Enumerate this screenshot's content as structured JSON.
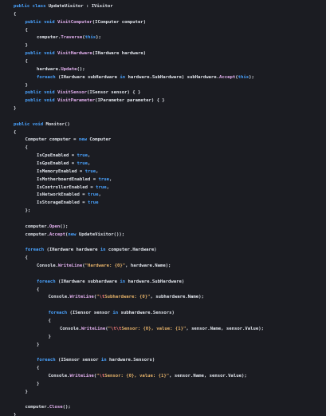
{
  "editor": {
    "theme_colors": {
      "background": "#1b1c22",
      "text": "#dfe3ea",
      "keyword": "#4aa3ff",
      "method": "#e4b1f0",
      "string": "#e7b36a",
      "escape": "#ff7e7e"
    },
    "lines": [
      {
        "indent": 0,
        "tokens": [
          {
            "t": "kw",
            "v": "public"
          },
          {
            "t": "txt",
            "v": " "
          },
          {
            "t": "kw",
            "v": "class"
          },
          {
            "t": "txt",
            "v": " UpdateVisitor : IVisitor"
          }
        ]
      },
      {
        "indent": 0,
        "tokens": [
          {
            "t": "txt",
            "v": "{"
          }
        ]
      },
      {
        "indent": 1,
        "tokens": [
          {
            "t": "kw",
            "v": "public"
          },
          {
            "t": "txt",
            "v": " "
          },
          {
            "t": "kw",
            "v": "void"
          },
          {
            "t": "txt",
            "v": " "
          },
          {
            "t": "mth",
            "v": "VisitComputer"
          },
          {
            "t": "txt",
            "v": "(IComputer computer)"
          }
        ]
      },
      {
        "indent": 1,
        "tokens": [
          {
            "t": "txt",
            "v": "{"
          }
        ]
      },
      {
        "indent": 2,
        "tokens": [
          {
            "t": "txt",
            "v": "computer."
          },
          {
            "t": "mth",
            "v": "Traverse"
          },
          {
            "t": "txt",
            "v": "("
          },
          {
            "t": "kw",
            "v": "this"
          },
          {
            "t": "txt",
            "v": ");"
          }
        ]
      },
      {
        "indent": 1,
        "tokens": [
          {
            "t": "txt",
            "v": "}"
          }
        ]
      },
      {
        "indent": 1,
        "tokens": [
          {
            "t": "kw",
            "v": "public"
          },
          {
            "t": "txt",
            "v": " "
          },
          {
            "t": "kw",
            "v": "void"
          },
          {
            "t": "txt",
            "v": " "
          },
          {
            "t": "mth",
            "v": "VisitHardware"
          },
          {
            "t": "txt",
            "v": "(IHardware hardware)"
          }
        ]
      },
      {
        "indent": 1,
        "tokens": [
          {
            "t": "txt",
            "v": "{"
          }
        ]
      },
      {
        "indent": 2,
        "tokens": [
          {
            "t": "txt",
            "v": "hardware."
          },
          {
            "t": "mth",
            "v": "Update"
          },
          {
            "t": "txt",
            "v": "();"
          }
        ]
      },
      {
        "indent": 2,
        "tokens": [
          {
            "t": "kw",
            "v": "foreach"
          },
          {
            "t": "txt",
            "v": " (IHardware subHardware "
          },
          {
            "t": "kw",
            "v": "in"
          },
          {
            "t": "txt",
            "v": " hardware.SubHardware) subHardware."
          },
          {
            "t": "mth",
            "v": "Accept"
          },
          {
            "t": "txt",
            "v": "("
          },
          {
            "t": "kw",
            "v": "this"
          },
          {
            "t": "txt",
            "v": ");"
          }
        ]
      },
      {
        "indent": 1,
        "tokens": [
          {
            "t": "txt",
            "v": "}"
          }
        ]
      },
      {
        "indent": 1,
        "tokens": [
          {
            "t": "kw",
            "v": "public"
          },
          {
            "t": "txt",
            "v": " "
          },
          {
            "t": "kw",
            "v": "void"
          },
          {
            "t": "txt",
            "v": " "
          },
          {
            "t": "mth",
            "v": "VisitSensor"
          },
          {
            "t": "txt",
            "v": "(ISensor sensor) { }"
          }
        ]
      },
      {
        "indent": 1,
        "tokens": [
          {
            "t": "kw",
            "v": "public"
          },
          {
            "t": "txt",
            "v": " "
          },
          {
            "t": "kw",
            "v": "void"
          },
          {
            "t": "txt",
            "v": " "
          },
          {
            "t": "mth",
            "v": "VisitParameter"
          },
          {
            "t": "txt",
            "v": "(IParameter parameter) { }"
          }
        ]
      },
      {
        "indent": 0,
        "tokens": [
          {
            "t": "txt",
            "v": "}"
          }
        ]
      },
      {
        "indent": 0,
        "tokens": []
      },
      {
        "indent": 0,
        "tokens": [
          {
            "t": "kw",
            "v": "public"
          },
          {
            "t": "txt",
            "v": " "
          },
          {
            "t": "kw",
            "v": "void"
          },
          {
            "t": "txt",
            "v": " Monitor()"
          }
        ]
      },
      {
        "indent": 0,
        "tokens": [
          {
            "t": "txt",
            "v": "{"
          }
        ]
      },
      {
        "indent": 1,
        "tokens": [
          {
            "t": "txt",
            "v": "Computer computer = "
          },
          {
            "t": "kw",
            "v": "new"
          },
          {
            "t": "txt",
            "v": " Computer"
          }
        ]
      },
      {
        "indent": 1,
        "tokens": [
          {
            "t": "txt",
            "v": "{"
          }
        ]
      },
      {
        "indent": 2,
        "tokens": [
          {
            "t": "txt",
            "v": "IsCpuEnabled = "
          },
          {
            "t": "kw",
            "v": "true"
          },
          {
            "t": "txt",
            "v": ","
          }
        ]
      },
      {
        "indent": 2,
        "tokens": [
          {
            "t": "txt",
            "v": "IsGpuEnabled = "
          },
          {
            "t": "kw",
            "v": "true"
          },
          {
            "t": "txt",
            "v": ","
          }
        ]
      },
      {
        "indent": 2,
        "tokens": [
          {
            "t": "txt",
            "v": "IsMemoryEnabled = "
          },
          {
            "t": "kw",
            "v": "true"
          },
          {
            "t": "txt",
            "v": ","
          }
        ]
      },
      {
        "indent": 2,
        "tokens": [
          {
            "t": "txt",
            "v": "IsMotherboardEnabled = "
          },
          {
            "t": "kw",
            "v": "true"
          },
          {
            "t": "txt",
            "v": ","
          }
        ]
      },
      {
        "indent": 2,
        "tokens": [
          {
            "t": "txt",
            "v": "IsControllerEnabled = "
          },
          {
            "t": "kw",
            "v": "true"
          },
          {
            "t": "txt",
            "v": ","
          }
        ]
      },
      {
        "indent": 2,
        "tokens": [
          {
            "t": "txt",
            "v": "IsNetworkEnabled = "
          },
          {
            "t": "kw",
            "v": "true"
          },
          {
            "t": "txt",
            "v": ","
          }
        ]
      },
      {
        "indent": 2,
        "tokens": [
          {
            "t": "txt",
            "v": "IsStorageEnabled = "
          },
          {
            "t": "kw",
            "v": "true"
          }
        ]
      },
      {
        "indent": 1,
        "tokens": [
          {
            "t": "txt",
            "v": "};"
          }
        ]
      },
      {
        "indent": 0,
        "tokens": []
      },
      {
        "indent": 1,
        "tokens": [
          {
            "t": "txt",
            "v": "computer."
          },
          {
            "t": "mth",
            "v": "Open"
          },
          {
            "t": "txt",
            "v": "();"
          }
        ]
      },
      {
        "indent": 1,
        "tokens": [
          {
            "t": "txt",
            "v": "computer."
          },
          {
            "t": "mth",
            "v": "Accept"
          },
          {
            "t": "txt",
            "v": "("
          },
          {
            "t": "kw",
            "v": "new"
          },
          {
            "t": "txt",
            "v": " UpdateVisitor());"
          }
        ]
      },
      {
        "indent": 0,
        "tokens": []
      },
      {
        "indent": 1,
        "tokens": [
          {
            "t": "kw",
            "v": "foreach"
          },
          {
            "t": "txt",
            "v": " (IHardware hardware "
          },
          {
            "t": "kw",
            "v": "in"
          },
          {
            "t": "txt",
            "v": " computer.Hardware)"
          }
        ]
      },
      {
        "indent": 1,
        "tokens": [
          {
            "t": "txt",
            "v": "{"
          }
        ]
      },
      {
        "indent": 2,
        "tokens": [
          {
            "t": "txt",
            "v": "Console."
          },
          {
            "t": "mth",
            "v": "WriteLine"
          },
          {
            "t": "txt",
            "v": "("
          },
          {
            "t": "str",
            "v": "\"Hardware: {0}\""
          },
          {
            "t": "txt",
            "v": ", hardware.Name);"
          }
        ]
      },
      {
        "indent": 0,
        "tokens": []
      },
      {
        "indent": 2,
        "tokens": [
          {
            "t": "kw",
            "v": "foreach"
          },
          {
            "t": "txt",
            "v": " (IHardware subhardware "
          },
          {
            "t": "kw",
            "v": "in"
          },
          {
            "t": "txt",
            "v": " hardware.SubHardware)"
          }
        ]
      },
      {
        "indent": 2,
        "tokens": [
          {
            "t": "txt",
            "v": "{"
          }
        ]
      },
      {
        "indent": 3,
        "tokens": [
          {
            "t": "txt",
            "v": "Console."
          },
          {
            "t": "mth",
            "v": "WriteLine"
          },
          {
            "t": "txt",
            "v": "("
          },
          {
            "t": "str",
            "v": "\""
          },
          {
            "t": "esc",
            "v": "\\t"
          },
          {
            "t": "str",
            "v": "Subhardware: {0}\""
          },
          {
            "t": "txt",
            "v": ", subhardware.Name);"
          }
        ]
      },
      {
        "indent": 0,
        "tokens": []
      },
      {
        "indent": 3,
        "tokens": [
          {
            "t": "kw",
            "v": "foreach"
          },
          {
            "t": "txt",
            "v": " (ISensor sensor "
          },
          {
            "t": "kw",
            "v": "in"
          },
          {
            "t": "txt",
            "v": " subhardware.Sensors)"
          }
        ]
      },
      {
        "indent": 3,
        "tokens": [
          {
            "t": "txt",
            "v": "{"
          }
        ]
      },
      {
        "indent": 4,
        "tokens": [
          {
            "t": "txt",
            "v": "Console."
          },
          {
            "t": "mth",
            "v": "WriteLine"
          },
          {
            "t": "txt",
            "v": "("
          },
          {
            "t": "str",
            "v": "\""
          },
          {
            "t": "esc",
            "v": "\\t\\t"
          },
          {
            "t": "str",
            "v": "Sensor: {0}, value: {1}\""
          },
          {
            "t": "txt",
            "v": ", sensor.Name, sensor.Value);"
          }
        ]
      },
      {
        "indent": 3,
        "tokens": [
          {
            "t": "txt",
            "v": "}"
          }
        ]
      },
      {
        "indent": 2,
        "tokens": [
          {
            "t": "txt",
            "v": "}"
          }
        ]
      },
      {
        "indent": 0,
        "tokens": []
      },
      {
        "indent": 2,
        "tokens": [
          {
            "t": "kw",
            "v": "foreach"
          },
          {
            "t": "txt",
            "v": " (ISensor sensor "
          },
          {
            "t": "kw",
            "v": "in"
          },
          {
            "t": "txt",
            "v": " hardware.Sensors)"
          }
        ]
      },
      {
        "indent": 2,
        "tokens": [
          {
            "t": "txt",
            "v": "{"
          }
        ]
      },
      {
        "indent": 3,
        "tokens": [
          {
            "t": "txt",
            "v": "Console."
          },
          {
            "t": "mth",
            "v": "WriteLine"
          },
          {
            "t": "txt",
            "v": "("
          },
          {
            "t": "str",
            "v": "\""
          },
          {
            "t": "esc",
            "v": "\\t"
          },
          {
            "t": "str",
            "v": "Sensor: {0}, value: {1}\""
          },
          {
            "t": "txt",
            "v": ", sensor.Name, sensor.Value);"
          }
        ]
      },
      {
        "indent": 2,
        "tokens": [
          {
            "t": "txt",
            "v": "}"
          }
        ]
      },
      {
        "indent": 1,
        "tokens": [
          {
            "t": "txt",
            "v": "}"
          }
        ]
      },
      {
        "indent": 0,
        "tokens": []
      },
      {
        "indent": 1,
        "tokens": [
          {
            "t": "txt",
            "v": "computer."
          },
          {
            "t": "mth",
            "v": "Close"
          },
          {
            "t": "txt",
            "v": "();"
          }
        ]
      },
      {
        "indent": 0,
        "tokens": [
          {
            "t": "txt",
            "v": "}"
          }
        ]
      }
    ]
  }
}
